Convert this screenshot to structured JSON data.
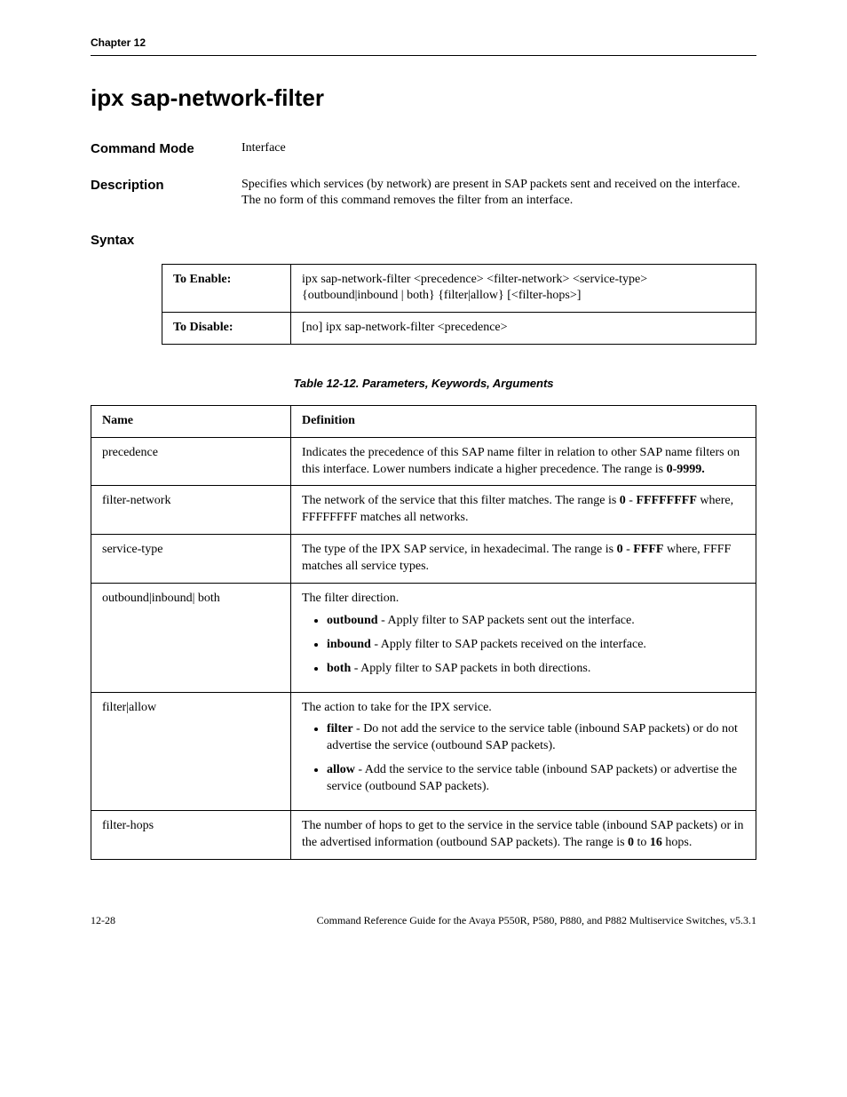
{
  "header": {
    "chapter": "Chapter 12"
  },
  "title": "ipx sap-network-filter",
  "sections": {
    "command_mode_label": "Command Mode",
    "command_mode_value": "Interface",
    "description_label": "Description",
    "description_value": "Specifies which services (by network) are present in SAP packets sent and received on the interface. The no form of this command removes the filter from an interface.",
    "syntax_label": "Syntax"
  },
  "syntax_table": {
    "enable_label": "To Enable:",
    "enable_value": "ipx sap-network-filter <precedence> <filter-network> <service-type> {outbound|inbound | both} {filter|allow} [<filter-hops>]",
    "disable_label": "To Disable:",
    "disable_value": "[no] ipx sap-network-filter <precedence>"
  },
  "table_caption": "Table 12-12.  Parameters, Keywords, Arguments",
  "params": {
    "header_name": "Name",
    "header_def": "Definition",
    "rows": [
      {
        "name": "precedence",
        "def_pre": "Indicates the precedence of this SAP name filter in relation to other SAP name filters on this interface. Lower numbers indicate a higher precedence. The range is ",
        "def_bold": "0-9999."
      },
      {
        "name": "filter-network",
        "def_pre": "The network of the service that this filter matches. The range is ",
        "def_bold": "0",
        "def_mid": " - ",
        "def_bold2": "FFFFFFFF",
        "def_post": " where, FFFFFFFF matches all networks."
      },
      {
        "name": "service-type",
        "def_pre": "The type of the IPX SAP service, in hexadecimal. The range is ",
        "def_bold": "0",
        "def_mid": " - ",
        "def_bold2": "FFFF",
        "def_post": " where, FFFF matches all service types."
      }
    ],
    "direction": {
      "name": "outbound|inbound| both",
      "intro": "The filter direction.",
      "items": [
        {
          "b": "outbound",
          "t": " - Apply filter to SAP packets sent out the interface."
        },
        {
          "b": "inbound",
          "t": " - Apply filter to SAP packets received on the interface."
        },
        {
          "b": "both",
          "t": " - Apply filter to SAP packets in both directions."
        }
      ]
    },
    "action": {
      "name": "filter|allow",
      "intro": "The action to take for the IPX service.",
      "items": [
        {
          "b": "filter",
          "t": " - Do not add the service to the service table (inbound SAP packets) or do not advertise the service (outbound SAP packets)."
        },
        {
          "b": "allow",
          "t": " - Add the service to the service table (inbound SAP packets) or advertise the service (outbound SAP packets)."
        }
      ]
    },
    "hops": {
      "name": "filter-hops",
      "pre": "The number of hops to get to the service in the service table (inbound SAP packets) or in the advertised information (outbound SAP packets). The range is ",
      "b1": "0",
      "mid": " to ",
      "b2": "16",
      "post": " hops."
    }
  },
  "footer": {
    "page": "12-28",
    "text": "Command Reference Guide for the Avaya P550R, P580, P880, and P882 Multiservice Switches, v5.3.1"
  }
}
